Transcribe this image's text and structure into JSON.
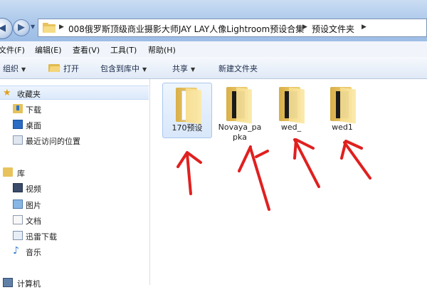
{
  "address": {
    "breadcrumbs": [
      "008俄罗斯顶级商业摄影大师JAY LAY人像Lightroom预设合集",
      "预设文件夹"
    ]
  },
  "menu": [
    "文件(F)",
    "编辑(E)",
    "查看(V)",
    "工具(T)",
    "帮助(H)"
  ],
  "toolbar": {
    "organize": "组织",
    "open": "打开",
    "include": "包含到库中",
    "share": "共享",
    "new_folder": "新建文件夹"
  },
  "nav": {
    "favorites": "收藏夹",
    "downloads": "下载",
    "desktop": "桌面",
    "recent": "最近访问的位置",
    "library": "库",
    "videos": "视频",
    "pictures": "图片",
    "documents": "文档",
    "xunlei": "迅雷下载",
    "music": "音乐",
    "computer": "计算机"
  },
  "files": [
    "170预设",
    "Novaya_papka",
    "wed_",
    "wed1"
  ],
  "colors": {
    "annotation": "#e0201f",
    "folder": "#e8c35d"
  }
}
